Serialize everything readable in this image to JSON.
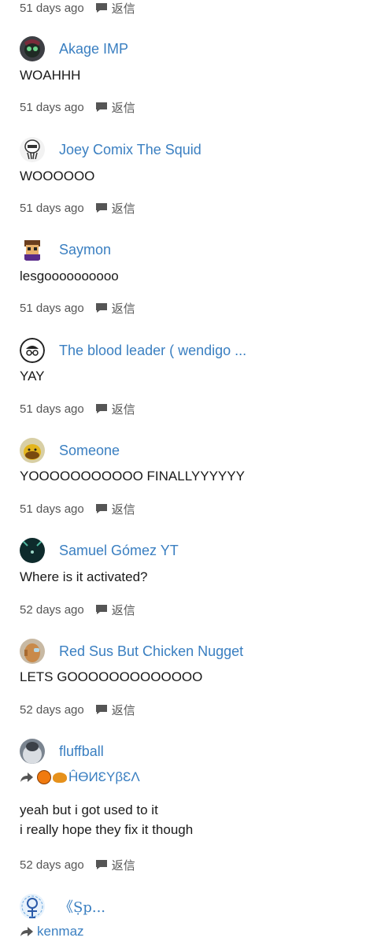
{
  "reply_label": "返信",
  "colors": {
    "link": "#3a7fc1",
    "meta": "#555555",
    "text": "#1a1a1a"
  },
  "comments": [
    {
      "time": "51 days ago"
    },
    {
      "user": "Akage IMP",
      "text": "WOAHHH",
      "time": "51 days ago"
    },
    {
      "user": "Joey Comix The Squid",
      "text": "WOOOOOO",
      "time": "51 days ago"
    },
    {
      "user": "Saymon",
      "text": "lesgoooooooooo",
      "time": "51 days ago"
    },
    {
      "user": "The blood leader ( wendigo ...",
      "text": "YAY",
      "time": "51 days ago"
    },
    {
      "user": "Someone",
      "text": "YOOOOOOOOOOO FINALLYYYYYY",
      "time": "51 days ago"
    },
    {
      "user": "Samuel Gómez YT",
      "text": "Where is it activated?",
      "time": "52 days ago"
    },
    {
      "user": "Red Sus But Chicken Nugget",
      "text": "LETS GOOOOOOOOOOOOO",
      "time": "52 days ago"
    },
    {
      "user": "fluffball",
      "reply_to": "ĤƟИƐYβƐΛ",
      "lines": [
        "yeah but i got used to it",
        "i really hope they fix it though"
      ],
      "time": "52 days ago"
    },
    {
      "user": "《Ṣp...",
      "reply_to": "kenmaz"
    }
  ]
}
